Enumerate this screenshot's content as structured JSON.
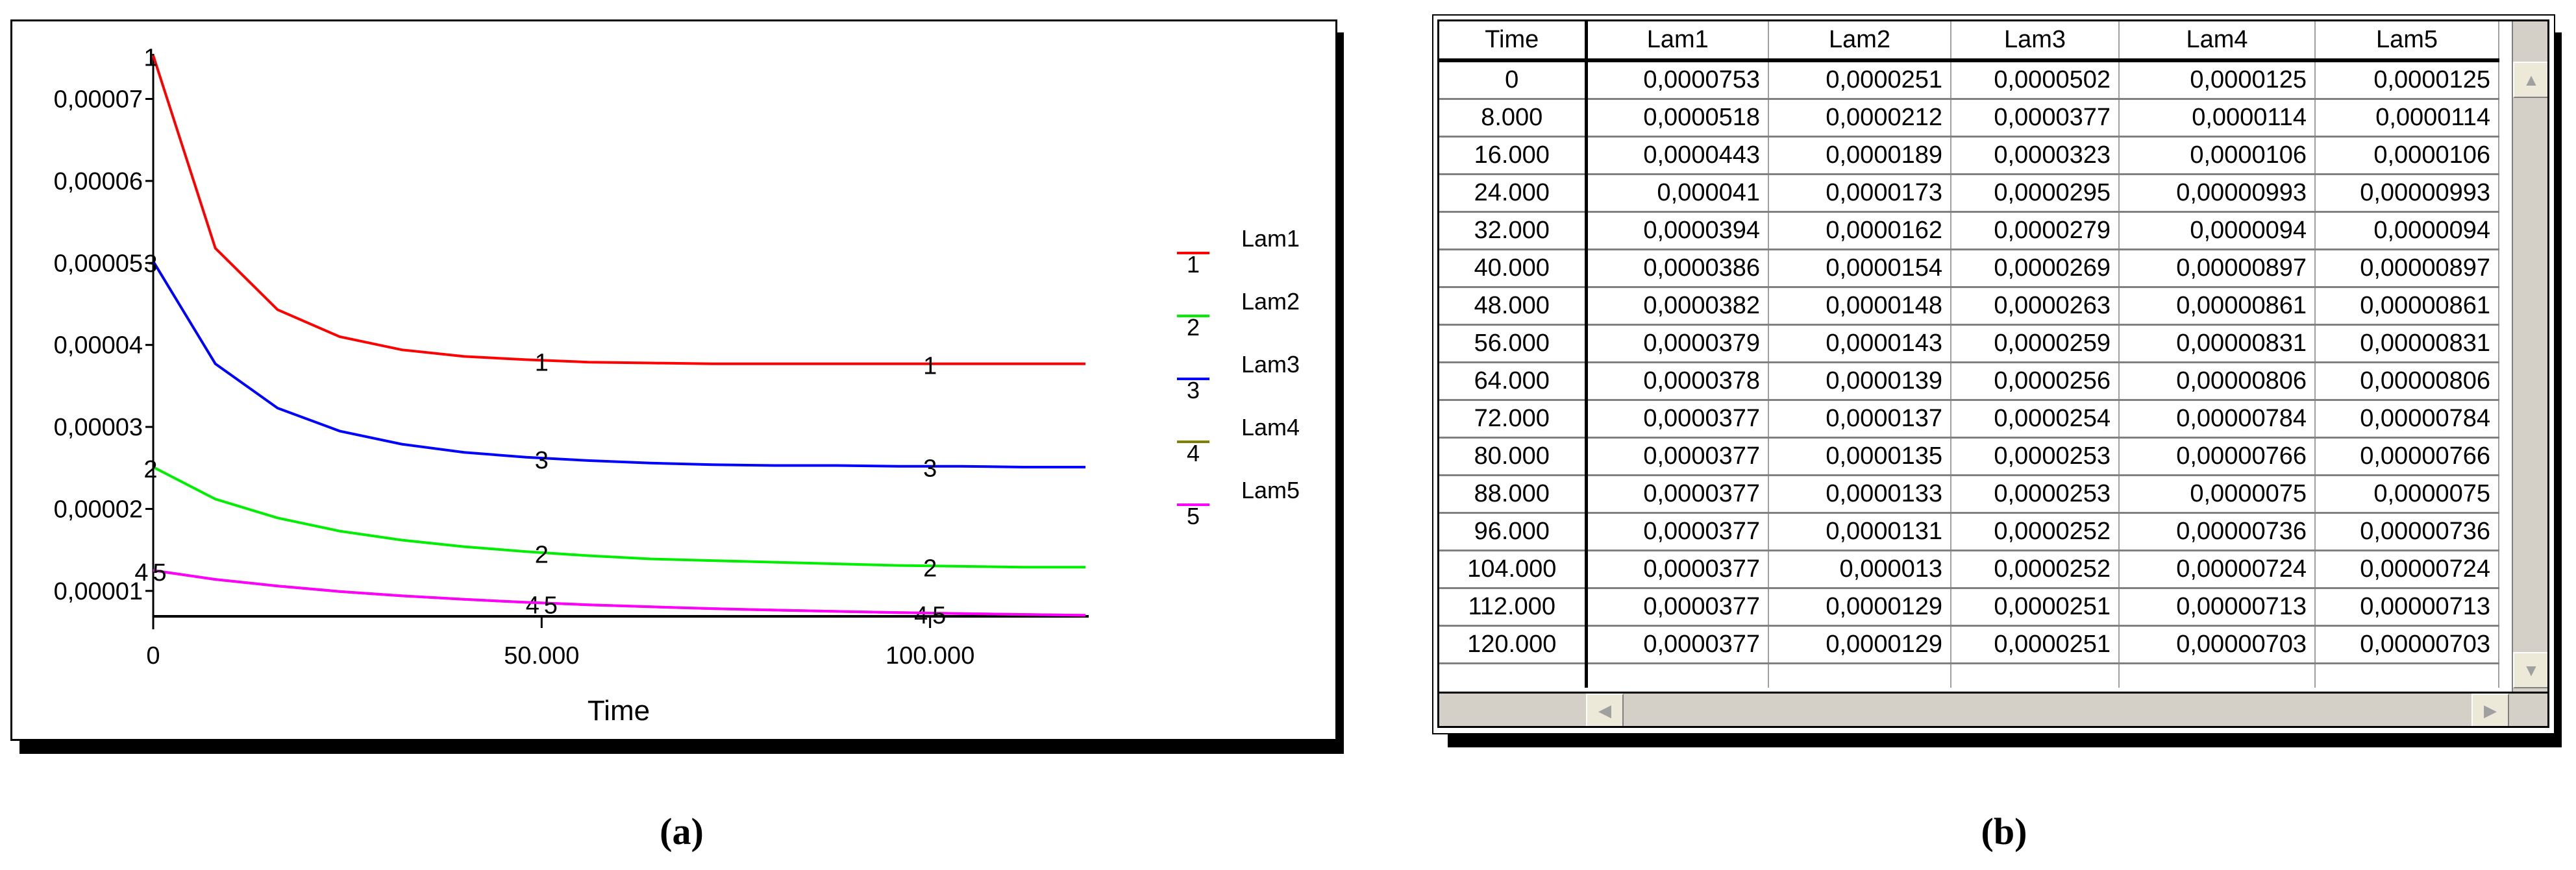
{
  "captions": {
    "a": "(a)",
    "b": "(b)"
  },
  "chart_data": {
    "type": "line",
    "title": "",
    "xlabel": "Time",
    "ylabel": "",
    "xlim": [
      0,
      120000
    ],
    "ylim": [
      6.9e-06,
      7.55e-05
    ],
    "grid": false,
    "legend_placement": "right",
    "x_ticks": [
      {
        "value": 0,
        "label": "0"
      },
      {
        "value": 50000,
        "label": "50.000"
      },
      {
        "value": 100000,
        "label": "100.000"
      }
    ],
    "y_ticks": [
      {
        "value": 1e-05,
        "label": "0,00001"
      },
      {
        "value": 2e-05,
        "label": "0,00002"
      },
      {
        "value": 3e-05,
        "label": "0,00003"
      },
      {
        "value": 4e-05,
        "label": "0,00004"
      },
      {
        "value": 5e-05,
        "label": "0,00005"
      },
      {
        "value": 6e-05,
        "label": "0,00006"
      },
      {
        "value": 7e-05,
        "label": "0,00007"
      }
    ],
    "x": [
      0,
      8000,
      16000,
      24000,
      32000,
      40000,
      48000,
      56000,
      64000,
      72000,
      80000,
      88000,
      96000,
      104000,
      112000,
      120000
    ],
    "series": [
      {
        "name": "Lam1",
        "marker": "1",
        "color": "#ff0000",
        "values": [
          7.53e-05,
          5.18e-05,
          4.43e-05,
          4.1e-05,
          3.94e-05,
          3.86e-05,
          3.82e-05,
          3.79e-05,
          3.78e-05,
          3.77e-05,
          3.77e-05,
          3.77e-05,
          3.77e-05,
          3.77e-05,
          3.77e-05,
          3.77e-05
        ]
      },
      {
        "name": "Lam2",
        "marker": "2",
        "color": "#00ee00",
        "values": [
          2.51e-05,
          2.12e-05,
          1.89e-05,
          1.73e-05,
          1.62e-05,
          1.54e-05,
          1.48e-05,
          1.43e-05,
          1.39e-05,
          1.37e-05,
          1.35e-05,
          1.33e-05,
          1.31e-05,
          1.3e-05,
          1.29e-05,
          1.29e-05
        ]
      },
      {
        "name": "Lam3",
        "marker": "3",
        "color": "#0000ff",
        "values": [
          5.02e-05,
          3.77e-05,
          3.23e-05,
          2.95e-05,
          2.79e-05,
          2.69e-05,
          2.63e-05,
          2.59e-05,
          2.56e-05,
          2.54e-05,
          2.53e-05,
          2.53e-05,
          2.52e-05,
          2.52e-05,
          2.51e-05,
          2.51e-05
        ]
      },
      {
        "name": "Lam4",
        "marker": "4",
        "color": "#808000",
        "values": [
          1.25e-05,
          1.14e-05,
          1.06e-05,
          9.93e-06,
          9.4e-06,
          8.97e-06,
          8.61e-06,
          8.31e-06,
          8.06e-06,
          7.84e-06,
          7.66e-06,
          7.5e-06,
          7.36e-06,
          7.24e-06,
          7.13e-06,
          7.03e-06
        ]
      },
      {
        "name": "Lam5",
        "marker": "5",
        "color": "#ff00ff",
        "values": [
          1.25e-05,
          1.14e-05,
          1.06e-05,
          9.93e-06,
          9.4e-06,
          8.97e-06,
          8.61e-06,
          8.31e-06,
          8.06e-06,
          7.84e-06,
          7.66e-06,
          7.5e-06,
          7.36e-06,
          7.24e-06,
          7.13e-06,
          7.03e-06
        ]
      }
    ]
  },
  "table": {
    "columns": [
      "Time",
      "Lam1",
      "Lam2",
      "Lam3",
      "Lam4",
      "Lam5"
    ],
    "rows": [
      [
        "0",
        "0,0000753",
        "0,0000251",
        "0,0000502",
        "0,0000125",
        "0,0000125"
      ],
      [
        "8.000",
        "0,0000518",
        "0,0000212",
        "0,0000377",
        "0,0000114",
        "0,0000114"
      ],
      [
        "16.000",
        "0,0000443",
        "0,0000189",
        "0,0000323",
        "0,0000106",
        "0,0000106"
      ],
      [
        "24.000",
        "0,000041",
        "0,0000173",
        "0,0000295",
        "0,00000993",
        "0,00000993"
      ],
      [
        "32.000",
        "0,0000394",
        "0,0000162",
        "0,0000279",
        "0,0000094",
        "0,0000094"
      ],
      [
        "40.000",
        "0,0000386",
        "0,0000154",
        "0,0000269",
        "0,00000897",
        "0,00000897"
      ],
      [
        "48.000",
        "0,0000382",
        "0,0000148",
        "0,0000263",
        "0,00000861",
        "0,00000861"
      ],
      [
        "56.000",
        "0,0000379",
        "0,0000143",
        "0,0000259",
        "0,00000831",
        "0,00000831"
      ],
      [
        "64.000",
        "0,0000378",
        "0,0000139",
        "0,0000256",
        "0,00000806",
        "0,00000806"
      ],
      [
        "72.000",
        "0,0000377",
        "0,0000137",
        "0,0000254",
        "0,00000784",
        "0,00000784"
      ],
      [
        "80.000",
        "0,0000377",
        "0,0000135",
        "0,0000253",
        "0,00000766",
        "0,00000766"
      ],
      [
        "88.000",
        "0,0000377",
        "0,0000133",
        "0,0000253",
        "0,0000075",
        "0,0000075"
      ],
      [
        "96.000",
        "0,0000377",
        "0,0000131",
        "0,0000252",
        "0,00000736",
        "0,00000736"
      ],
      [
        "104.000",
        "0,0000377",
        "0,000013",
        "0,0000252",
        "0,00000724",
        "0,00000724"
      ],
      [
        "112.000",
        "0,0000377",
        "0,0000129",
        "0,0000251",
        "0,00000713",
        "0,00000713"
      ],
      [
        "120.000",
        "0,0000377",
        "0,0000129",
        "0,0000251",
        "0,00000703",
        "0,00000703"
      ]
    ]
  }
}
